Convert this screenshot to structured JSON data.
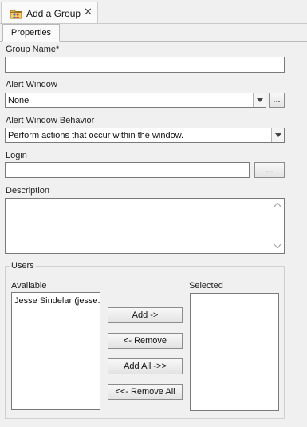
{
  "document_tab": {
    "title": "Add a Group",
    "icon": "folder-group-icon",
    "close_glyph": "✕"
  },
  "property_tabs": [
    {
      "label": "Properties",
      "active": true
    }
  ],
  "fields": {
    "group_name": {
      "label": "Group Name*",
      "value": ""
    },
    "alert_window": {
      "label": "Alert Window",
      "selected": "None",
      "browse_label": "..."
    },
    "alert_window_behavior": {
      "label": "Alert Window Behavior",
      "selected": "Perform actions that occur within the window."
    },
    "login": {
      "label": "Login",
      "value": "",
      "browse_label": "..."
    },
    "description": {
      "label": "Description",
      "value": ""
    }
  },
  "users": {
    "title": "Users",
    "available_label": "Available",
    "selected_label": "Selected",
    "available": [
      "Jesse Sindelar (jesse.s"
    ],
    "selected": [],
    "buttons": {
      "add": "Add ->",
      "remove": "<- Remove",
      "add_all": "Add All ->>",
      "remove_all": "<<- Remove All"
    }
  }
}
